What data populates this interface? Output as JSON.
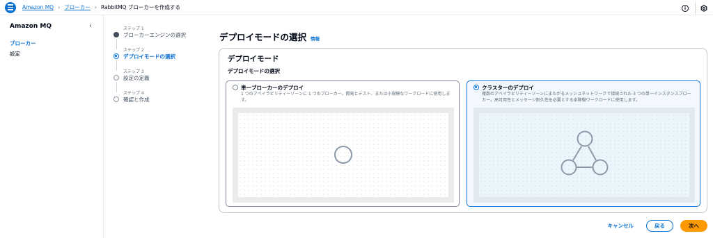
{
  "topbar": {
    "breadcrumbs": [
      {
        "label": "Amazon MQ"
      },
      {
        "label": "ブローカー"
      },
      {
        "label": "RabbitMQ ブローカーを作成する"
      }
    ],
    "icons": [
      "menu-icon",
      "info-icon",
      "settings-icon"
    ]
  },
  "sidenav": {
    "title": "Amazon MQ",
    "items": [
      {
        "label": "ブローカー"
      },
      {
        "label": "設定"
      }
    ]
  },
  "steps": [
    {
      "label": "ステップ 1",
      "name": "ブローカーエンジンの選択",
      "state": "completed"
    },
    {
      "label": "ステップ 2",
      "name": "デプロイモードの選択",
      "state": "current"
    },
    {
      "label": "ステップ 3",
      "name": "設定の定義",
      "state": "pending"
    },
    {
      "label": "ステップ 4",
      "name": "確認と作成",
      "state": "pending"
    }
  ],
  "page": {
    "title": "デプロイモードの選択",
    "info_link": "情報"
  },
  "container": {
    "header": "デプロイモード",
    "field_label": "デプロイモードの選択",
    "options": [
      {
        "title": "単一ブローカーのデプロイ",
        "description": "1 つのアベイラビリティーゾーンに 1 つのブローカー。開発とテスト、または小規模なワークロードに使用します。",
        "selected": false
      },
      {
        "title": "クラスターのデプロイ",
        "description": "複数のアベイラビリティーゾーンにまたがるメッシュネットワークで接続された 3 つの単一インスタンスブローカー。高可用性とメッセージ耐久性を必要とする本稼働ワークロードに使用します。",
        "selected": true
      }
    ]
  },
  "footer": {
    "cancel": "キャンセル",
    "back": "戻る",
    "next": "次へ"
  },
  "colors": {
    "accent": "#0972d3",
    "primary_button": "#ff9900"
  }
}
